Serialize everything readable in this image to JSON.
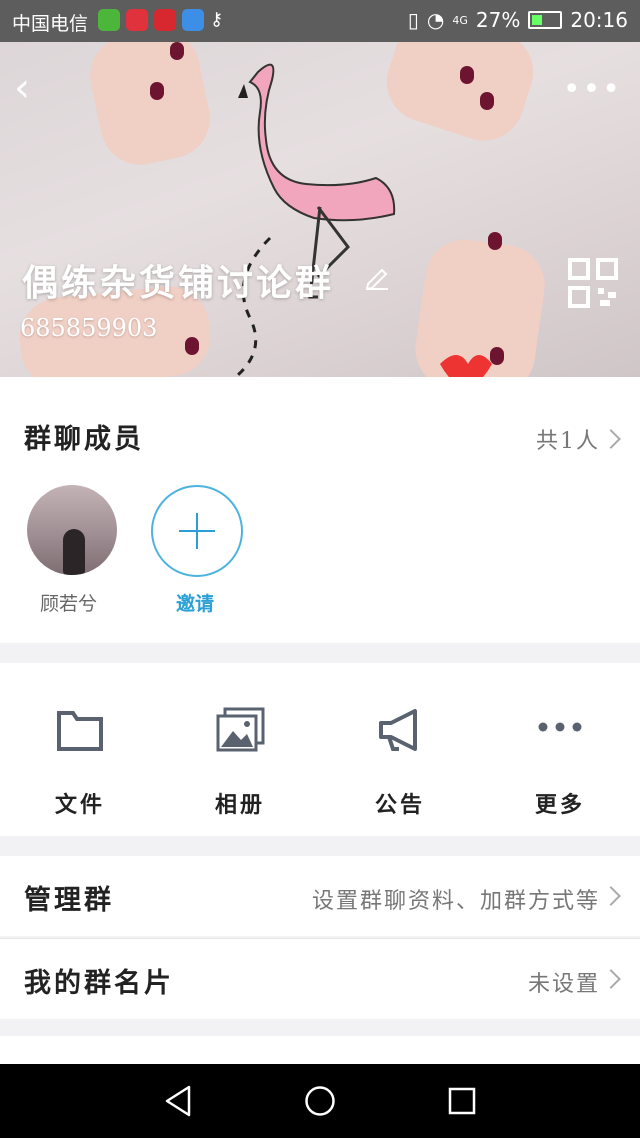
{
  "status_bar": {
    "carrier": "中国电信",
    "app_icons": [
      {
        "name": "wechat-app-icon",
        "color": "#4cb63b"
      },
      {
        "name": "weibo-app-icon",
        "color": "#e0323c"
      },
      {
        "name": "netease-app-icon",
        "color": "#d7282f"
      },
      {
        "name": "browser-app-icon",
        "color": "#3d8ee6"
      },
      {
        "name": "key-icon",
        "color": "#ffffff"
      }
    ],
    "battery": "27%",
    "time": "20:16",
    "network": "4G"
  },
  "header": {
    "back_icon": "‹",
    "more_icon": "•••",
    "group_name": "偶练杂货铺讨论群",
    "group_id": "685859903"
  },
  "members": {
    "title": "群聊成员",
    "count": "共1人",
    "list": [
      {
        "name": "顾若兮"
      }
    ],
    "invite_label": "邀请"
  },
  "toolbar": {
    "items": [
      {
        "id": "files",
        "label": "文件",
        "icon": "folder-icon"
      },
      {
        "id": "album",
        "label": "相册",
        "icon": "album-icon"
      },
      {
        "id": "announcement",
        "label": "公告",
        "icon": "megaphone-icon"
      },
      {
        "id": "more",
        "label": "更多",
        "icon": "more-dots-icon"
      }
    ]
  },
  "rows": {
    "manage": {
      "title": "管理群",
      "value": "设置群聊资料、加群方式等"
    },
    "card": {
      "title": "我的群名片",
      "value": "未设置"
    }
  },
  "colors": {
    "accent": "#2aa0d6",
    "icon_gray": "#5a6270"
  }
}
